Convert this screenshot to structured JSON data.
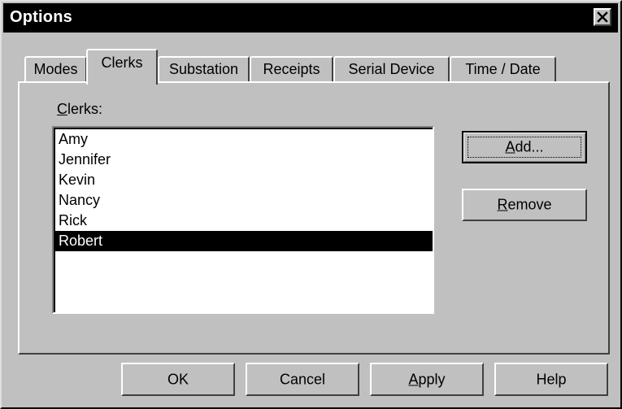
{
  "window": {
    "title": "Options",
    "close_icon": "close-icon"
  },
  "tabs": [
    {
      "label": "Modes",
      "active": false
    },
    {
      "label": "Clerks",
      "active": true
    },
    {
      "label": "Substation",
      "active": false
    },
    {
      "label": "Receipts",
      "active": false
    },
    {
      "label": "Serial Device",
      "active": false
    },
    {
      "label": "Time / Date",
      "active": false
    }
  ],
  "clerks_panel": {
    "label_mnemonic": "C",
    "label_rest": "lerks:",
    "items": [
      "Amy",
      "Jennifer",
      "Kevin",
      "Nancy",
      "Rick",
      "Robert"
    ],
    "selected": "Robert",
    "add_button": {
      "mnemonic": "A",
      "rest": "dd..."
    },
    "remove_button": {
      "mnemonic": "R",
      "rest": "emove"
    }
  },
  "footer": {
    "ok_label": "OK",
    "cancel_label": "Cancel",
    "apply_mnemonic": "A",
    "apply_rest": "pply",
    "help_label": "Help"
  },
  "colors": {
    "dialog_face": "#c0c0c0",
    "titlebar": "#000000",
    "selection": "#000000"
  }
}
